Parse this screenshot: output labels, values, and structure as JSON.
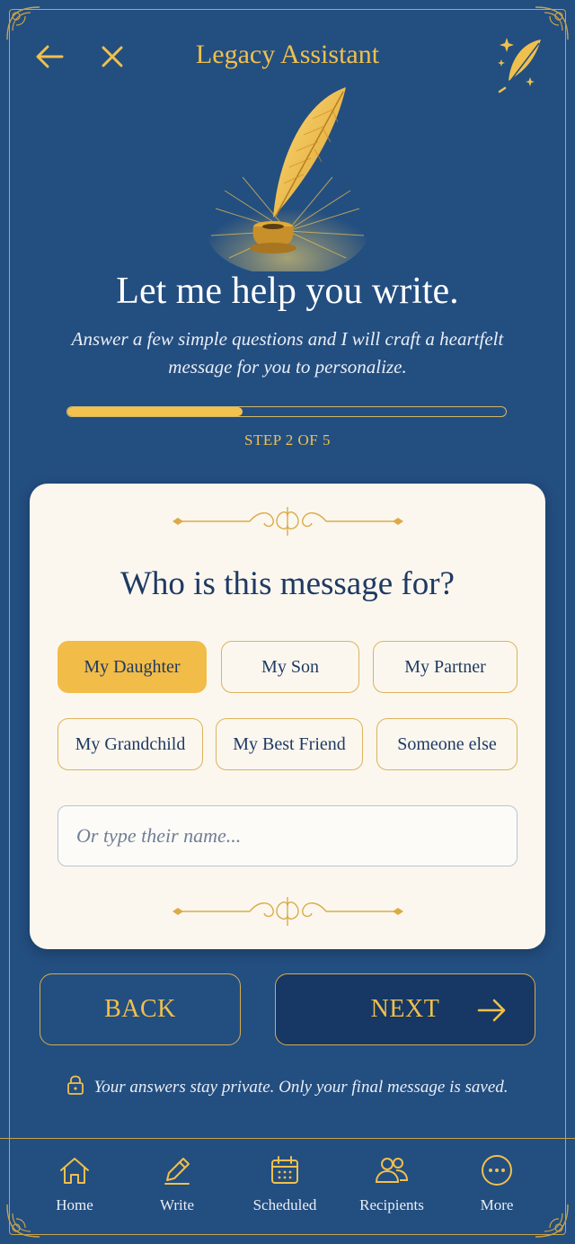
{
  "header": {
    "title": "Legacy Assistant",
    "back_icon": "arrow-left-icon",
    "close_icon": "close-icon",
    "brand_icon": "feather-quill-icon"
  },
  "hero": {
    "headline": "Let me help you write.",
    "subtext": "Answer a few simple questions and I will craft a heartfelt message for you to personalize."
  },
  "progress": {
    "current_step": 2,
    "total_steps": 5,
    "fill_fraction": 0.4,
    "label": "STEP 2 OF 5"
  },
  "card": {
    "question": "Who is this message for?",
    "options": [
      {
        "label": "My Daughter",
        "selected": true
      },
      {
        "label": "My Son",
        "selected": false
      },
      {
        "label": "My Partner",
        "selected": false
      },
      {
        "label": "My Grandchild",
        "selected": false
      },
      {
        "label": "My Best Friend",
        "selected": false
      },
      {
        "label": "Someone else",
        "selected": false
      }
    ],
    "name_input": {
      "value": "",
      "placeholder": "Or type their name..."
    }
  },
  "actions": {
    "back_label": "BACK",
    "next_label": "NEXT"
  },
  "privacy_note": "Your answers stay private. Only your final message is saved.",
  "nav": {
    "items": [
      {
        "label": "Home",
        "icon": "home-icon"
      },
      {
        "label": "Write",
        "icon": "pencil-icon"
      },
      {
        "label": "Scheduled",
        "icon": "calendar-icon"
      },
      {
        "label": "Recipients",
        "icon": "people-icon"
      },
      {
        "label": "More",
        "icon": "more-icon"
      }
    ]
  },
  "colors": {
    "background": "#234e80",
    "accent_gold": "#f0c04d",
    "card": "#fbf7ef",
    "navy_text": "#1e3a63",
    "next_button": "#173764"
  }
}
